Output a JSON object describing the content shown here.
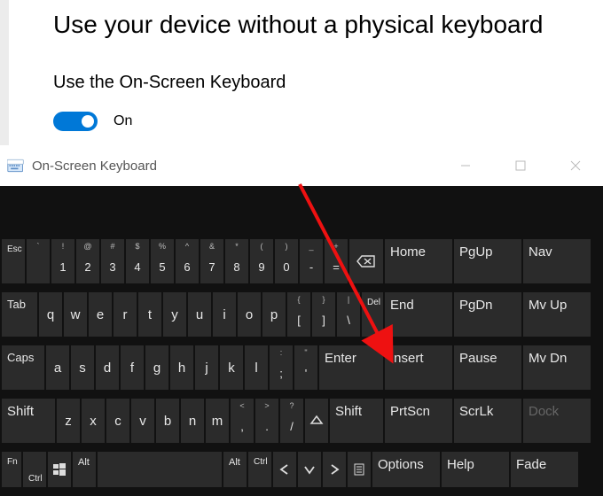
{
  "settings": {
    "page_title": "Use your device without a physical keyboard",
    "option_label": "Use the On-Screen Keyboard",
    "toggle_state": "On"
  },
  "osk": {
    "title": "On-Screen Keyboard",
    "row1": {
      "esc": "Esc",
      "keys": [
        {
          "sup": "`",
          "main": ""
        },
        {
          "sup": "!",
          "main": "1"
        },
        {
          "sup": "@",
          "main": "2"
        },
        {
          "sup": "#",
          "main": "3"
        },
        {
          "sup": "$",
          "main": "4"
        },
        {
          "sup": "%",
          "main": "5"
        },
        {
          "sup": "^",
          "main": "6"
        },
        {
          "sup": "&",
          "main": "7"
        },
        {
          "sup": "*",
          "main": "8"
        },
        {
          "sup": "(",
          "main": "9"
        },
        {
          "sup": ")",
          "main": "0"
        },
        {
          "sup": "_",
          "main": "-"
        },
        {
          "sup": "+",
          "main": "="
        }
      ],
      "home": "Home",
      "pgup": "PgUp",
      "nav": "Nav"
    },
    "row2": {
      "tab": "Tab",
      "letters": [
        "q",
        "w",
        "e",
        "r",
        "t",
        "y",
        "u",
        "i",
        "o",
        "p"
      ],
      "extras": [
        {
          "sup": "{",
          "main": "["
        },
        {
          "sup": "}",
          "main": "]"
        },
        {
          "sup": "|",
          "main": "\\"
        }
      ],
      "del": "Del",
      "end": "End",
      "pgdn": "PgDn",
      "mvup": "Mv Up"
    },
    "row3": {
      "caps": "Caps",
      "letters": [
        "a",
        "s",
        "d",
        "f",
        "g",
        "h",
        "j",
        "k",
        "l"
      ],
      "extras": [
        {
          "sup": ":",
          "main": ";"
        },
        {
          "sup": "\"",
          "main": "'"
        }
      ],
      "enter": "Enter",
      "insert": "Insert",
      "pause": "Pause",
      "mvdn": "Mv Dn"
    },
    "row4": {
      "shift_l": "Shift",
      "letters": [
        "z",
        "x",
        "c",
        "v",
        "b",
        "n",
        "m"
      ],
      "extras": [
        {
          "sup": "<",
          "main": ","
        },
        {
          "sup": ">",
          "main": "."
        },
        {
          "sup": "?",
          "main": "/"
        }
      ],
      "shift_r": "Shift",
      "prtscn": "PrtScn",
      "scrlk": "ScrLk",
      "dock": "Dock"
    },
    "row5": {
      "fn": "Fn",
      "ctrl_l": "Ctrl",
      "alt_l": "Alt",
      "alt_r": "Alt",
      "ctrl_r": "Ctrl",
      "options": "Options",
      "help": "Help",
      "fade": "Fade"
    }
  }
}
